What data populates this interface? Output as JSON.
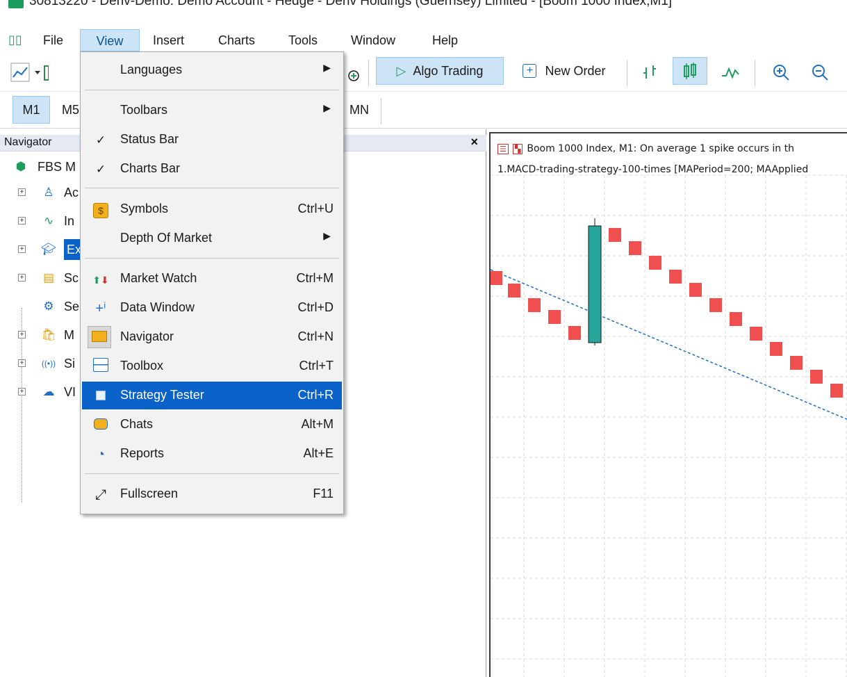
{
  "window": {
    "title": "30813220 - Deriv-Demo: Demo Account - Hedge - Deriv Holdings (Guernsey) Limited - [Boom 1000 Index,M1]"
  },
  "menubar": {
    "items": [
      "File",
      "View",
      "Insert",
      "Charts",
      "Tools",
      "Window",
      "Help"
    ],
    "active": "View"
  },
  "toolbar": {
    "algo_trading": "Algo Trading",
    "new_order": "New Order"
  },
  "timeframes": {
    "visible": [
      "M1",
      "M5",
      "MN"
    ],
    "selected": "M1"
  },
  "navigator": {
    "title": "Navigator",
    "close": "×",
    "items": [
      {
        "label": "FBS M",
        "icon": "mt5-root-icon"
      },
      {
        "label": "Ac",
        "icon": "accounts-icon"
      },
      {
        "label": "In",
        "icon": "indicators-icon"
      },
      {
        "label": "Ex",
        "icon": "experts-icon",
        "selected": true
      },
      {
        "label": "Sc",
        "icon": "scripts-icon"
      },
      {
        "label": "Se",
        "icon": "services-icon"
      },
      {
        "label": "M",
        "icon": "market-icon"
      },
      {
        "label": "Si",
        "icon": "signals-icon"
      },
      {
        "label": "VI",
        "icon": "vps-icon"
      }
    ]
  },
  "view_menu": {
    "items": [
      {
        "label": "Languages",
        "submenu": true
      },
      {
        "label": "Toolbars",
        "submenu": true
      },
      {
        "label": "Status Bar",
        "checked": true
      },
      {
        "label": "Charts Bar",
        "checked": true
      },
      {
        "label": "Symbols",
        "shortcut": "Ctrl+U",
        "icon": "symbols-icon"
      },
      {
        "label": "Depth Of Market",
        "submenu": true
      },
      {
        "label": "Market Watch",
        "shortcut": "Ctrl+M",
        "icon": "market-watch-icon"
      },
      {
        "label": "Data Window",
        "shortcut": "Ctrl+D",
        "icon": "data-window-icon"
      },
      {
        "label": "Navigator",
        "shortcut": "Ctrl+N",
        "icon": "navigator-icon"
      },
      {
        "label": "Toolbox",
        "shortcut": "Ctrl+T",
        "icon": "toolbox-icon"
      },
      {
        "label": "Strategy Tester",
        "shortcut": "Ctrl+R",
        "icon": "strategy-tester-icon",
        "highlighted": true
      },
      {
        "label": "Chats",
        "shortcut": "Alt+M",
        "icon": "chats-icon"
      },
      {
        "label": "Reports",
        "shortcut": "Alt+E",
        "icon": "reports-icon"
      },
      {
        "label": "Fullscreen",
        "shortcut": "F11",
        "icon": "fullscreen-icon"
      }
    ]
  },
  "chart": {
    "info_line1": "Boom 1000 Index, M1:  On average 1 spike occurs in th",
    "info_line2": "1.MACD-trading-strategy-100-times [MAPeriod=200; MAApplied",
    "colors": {
      "bear_candle": "#ef4f4f",
      "bull_candle": "#26a69a",
      "ma_line": "#1f6fc5",
      "grid": "#d8d8d8"
    }
  }
}
